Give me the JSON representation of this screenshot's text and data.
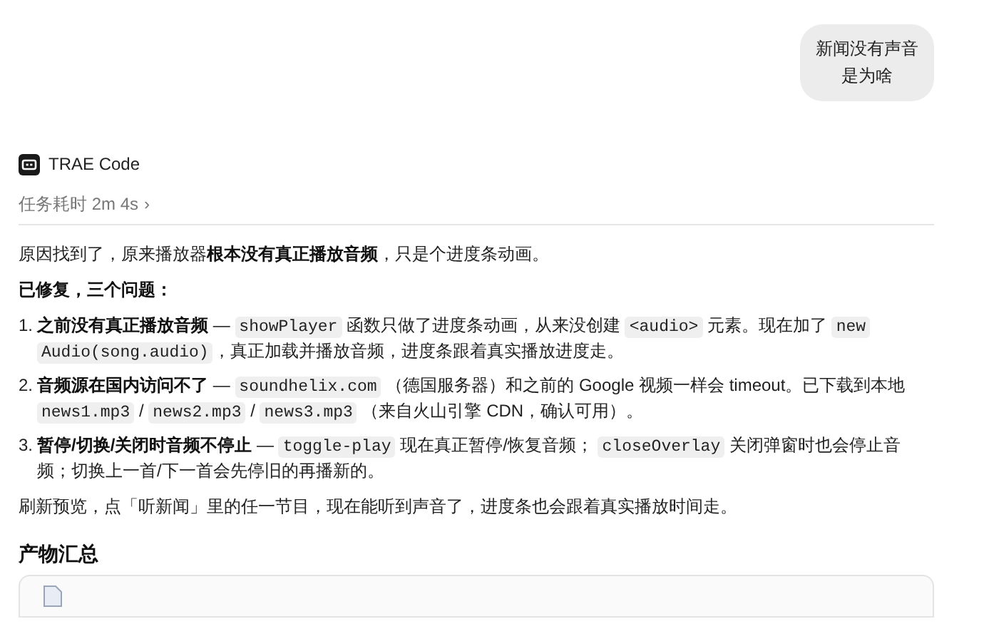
{
  "user_message": {
    "text": "新闻没有声音是为啥"
  },
  "agent": {
    "name": "TRAE Code",
    "duration": "任务耗时 2m 4s",
    "duration_chevron": "›"
  },
  "reply": [
    {
      "kind": "paragraph",
      "segments": [
        {
          "kind": "text",
          "text": "原因找到了，原来播放器"
        },
        {
          "kind": "bold",
          "text": "根本没有真正播放音频"
        },
        {
          "kind": "text",
          "text": "，只是个进度条动画。"
        }
      ]
    },
    {
      "kind": "paragraph",
      "segments": [
        {
          "kind": "bold",
          "text": "已修复，三个问题："
        }
      ]
    },
    {
      "kind": "list",
      "items": [
        {
          "number": "1.",
          "segments": [
            {
              "kind": "bold",
              "text": "之前没有真正播放音频"
            },
            {
              "kind": "text",
              "text": " — "
            },
            {
              "kind": "code",
              "text": "showPlayer"
            },
            {
              "kind": "text",
              "text": " 函数只做了进度条动画，从来没创建 "
            },
            {
              "kind": "code",
              "text": "<audio>"
            },
            {
              "kind": "text",
              "text": " 元素。现在加了 "
            },
            {
              "kind": "code",
              "text": "new Audio(song.audio)"
            },
            {
              "kind": "text",
              "text": "，真正加载并播放音频，进度条跟着真实播放进度走。"
            }
          ]
        },
        {
          "number": "2.",
          "segments": [
            {
              "kind": "bold",
              "text": "音频源在国内访问不了"
            },
            {
              "kind": "text",
              "text": " — "
            },
            {
              "kind": "code",
              "text": "soundhelix.com"
            },
            {
              "kind": "text",
              "text": " （德国服务器）和之前的 Google 视频一样会 timeout。已下载到本地 "
            },
            {
              "kind": "code",
              "text": "news1.mp3"
            },
            {
              "kind": "text",
              "text": " / "
            },
            {
              "kind": "code",
              "text": "news2.mp3"
            },
            {
              "kind": "text",
              "text": " / "
            },
            {
              "kind": "code",
              "text": "news3.mp3"
            },
            {
              "kind": "text",
              "text": " （来自火山引擎 CDN，确认可用）。"
            }
          ]
        },
        {
          "number": "3.",
          "segments": [
            {
              "kind": "bold",
              "text": "暂停/切换/关闭时音频不停止"
            },
            {
              "kind": "text",
              "text": " — "
            },
            {
              "kind": "code",
              "text": "toggle-play"
            },
            {
              "kind": "text",
              "text": " 现在真正暂停/恢复音频； "
            },
            {
              "kind": "code",
              "text": "closeOverlay"
            },
            {
              "kind": "text",
              "text": " 关闭弹窗时也会停止音频；切换上一首/下一首会先停旧的再播新的。"
            }
          ]
        }
      ]
    },
    {
      "kind": "paragraph",
      "segments": [
        {
          "kind": "text",
          "text": "刷新预览，点「听新闻」里的任一节目，现在能听到声音了，进度条也会跟着真实播放时间走。"
        }
      ]
    },
    {
      "kind": "heading",
      "text": "产物汇总"
    }
  ]
}
